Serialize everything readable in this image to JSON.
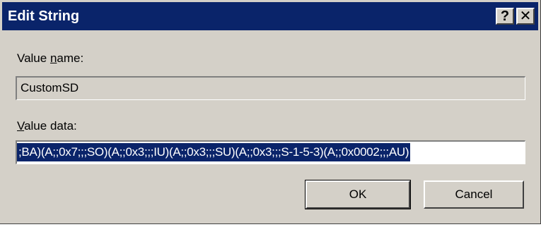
{
  "window": {
    "title": "Edit String",
    "help_button": "?",
    "close_button": "✕"
  },
  "value_name": {
    "label_pre": "Value ",
    "label_accel": "n",
    "label_post": "ame:",
    "value": "CustomSD"
  },
  "value_data": {
    "label_pre": "",
    "label_accel": "V",
    "label_post": "alue data:",
    "value": ";BA)(A;;0x7;;;SO)(A;;0x3;;;IU)(A;;0x3;;;SU)(A;;0x3;;;S-1-5-3)(A;;0x0002;;;AU)"
  },
  "buttons": {
    "ok": "OK",
    "cancel": "Cancel"
  },
  "colors": {
    "titlebar": "#0a246a",
    "dialog_bg": "#d4d0c8",
    "selection": "#0a246a"
  }
}
